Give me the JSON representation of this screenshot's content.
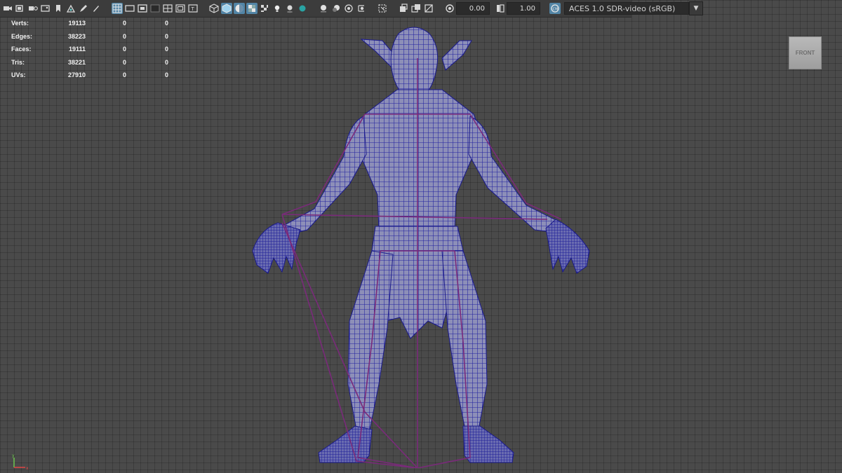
{
  "toolbar": {
    "exposure_value": "0.00",
    "gamma_value": "1.00",
    "color_space": "ACES 1.0 SDR-video (sRGB)"
  },
  "hud": {
    "rows": [
      {
        "label": "Verts:",
        "v1": "19113",
        "v2": "0",
        "v3": "0"
      },
      {
        "label": "Edges:",
        "v1": "38223",
        "v2": "0",
        "v3": "0"
      },
      {
        "label": "Faces:",
        "v1": "19111",
        "v2": "0",
        "v3": "0"
      },
      {
        "label": "Tris:",
        "v1": "38221",
        "v2": "0",
        "v3": "0"
      },
      {
        "label": "UVs:",
        "v1": "27910",
        "v2": "0",
        "v3": "0"
      }
    ]
  },
  "viewcube": {
    "label": "FRONT"
  },
  "colors": {
    "wireframe": "#2a2aa8",
    "skeleton": "#7a2a7a",
    "viewport_bg": "#4a4a4a",
    "toolbar_active": "#5285a6"
  },
  "icons": [
    "camera-icon",
    "camera-attributes-icon",
    "bookmark-icon",
    "image-plane-icon",
    "grid-icon",
    "film-gate-icon",
    "resolution-gate-icon",
    "wireframe-icon",
    "smooth-shade-icon",
    "textured-icon",
    "lights-icon",
    "shadows-icon",
    "ambient-occlusion-icon",
    "isolate-icon",
    "xray-icon",
    "exposure-icon",
    "gamma-icon",
    "color-management-icon"
  ]
}
